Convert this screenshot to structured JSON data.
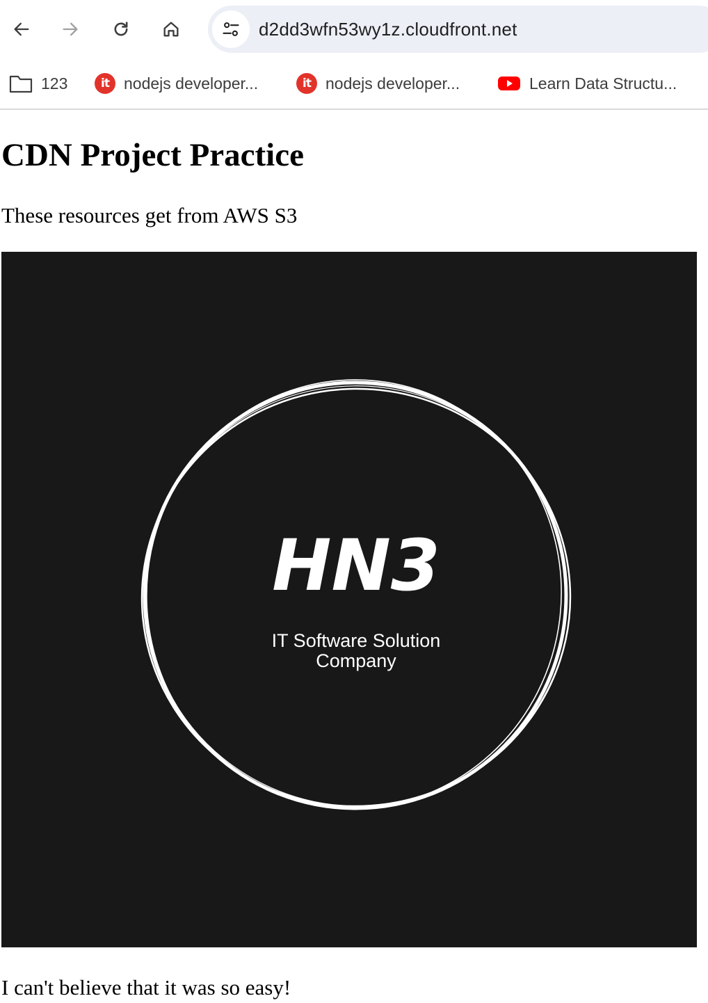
{
  "browser": {
    "url": "d2dd3wfn53wy1z.cloudfront.net",
    "nav": {
      "back_icon": "arrow-left-icon",
      "forward_icon": "arrow-right-icon",
      "reload_icon": "reload-icon",
      "home_icon": "home-icon",
      "site_info_icon": "tune-icon"
    },
    "bookmarks": [
      {
        "label": "123",
        "icon": "folder-icon"
      },
      {
        "label": "nodejs developer...",
        "icon": "itviec-icon",
        "icon_text": "it"
      },
      {
        "label": "nodejs developer...",
        "icon": "itviec-icon",
        "icon_text": "it"
      },
      {
        "label": "Learn Data Structu...",
        "icon": "youtube-icon"
      }
    ]
  },
  "page": {
    "title": "CDN Project Practice",
    "subtitle": "These resources get from AWS S3",
    "image": {
      "logo_text": "HN3",
      "tagline_line1": "IT Software Solution",
      "tagline_line2": "Company"
    },
    "footer_text": "I can't believe that it was so easy!"
  },
  "colors": {
    "logo_background": "#181818",
    "omnibox_background": "#eceff6",
    "itviec_red": "#e2332b",
    "youtube_red": "#ff0000"
  }
}
